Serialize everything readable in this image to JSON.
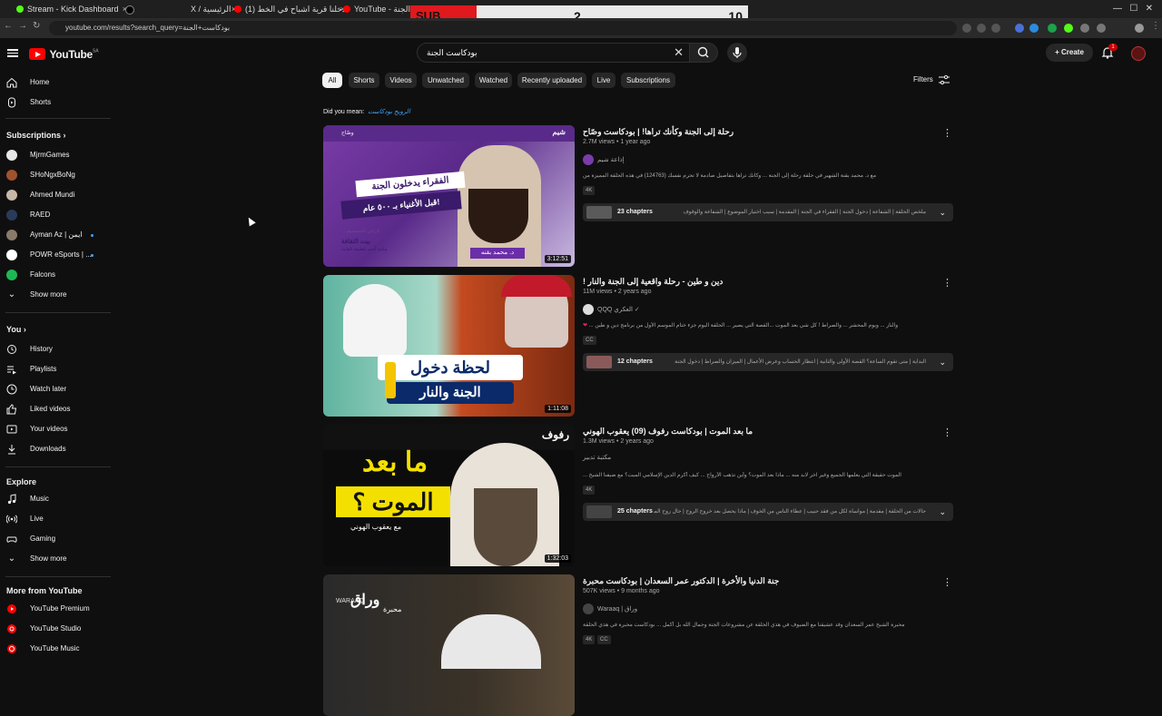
{
  "browser": {
    "tabs": [
      {
        "label": "Stream - Kick Dashboard"
      },
      {
        "label": "X / الرئيسية"
      },
      {
        "label": "(1) دخلنا قرية اشباح في الخط"
      },
      {
        "label": "YouTube - بودكاست الجنة"
      }
    ],
    "url": "youtube.com/results?search_query=بودكاست+الجنة"
  },
  "overlay": {
    "sub_label": "SUB",
    "count": "2",
    "goal": "10"
  },
  "header": {
    "logo_text": "YouTube",
    "region": "SA",
    "search_value": "بودكاست الجنة",
    "create_label": "Create",
    "notif_count": "1"
  },
  "sidebar": {
    "main": [
      {
        "label": "Home"
      },
      {
        "label": "Shorts"
      }
    ],
    "subscriptions_title": "Subscriptions",
    "subscriptions": [
      {
        "label": "MjrmGames"
      },
      {
        "label": "SHoNgxBoNg"
      },
      {
        "label": "Ahmed Mundi"
      },
      {
        "label": "RAED"
      },
      {
        "label": "Ayman Az | ايمن"
      },
      {
        "label": "POWR eSports | ..."
      },
      {
        "label": "Falcons"
      },
      {
        "label": "Show more"
      }
    ],
    "you_title": "You",
    "you": [
      {
        "label": "History"
      },
      {
        "label": "Playlists"
      },
      {
        "label": "Watch later"
      },
      {
        "label": "Liked videos"
      },
      {
        "label": "Your videos"
      },
      {
        "label": "Downloads"
      }
    ],
    "explore_title": "Explore",
    "explore": [
      {
        "label": "Music"
      },
      {
        "label": "Live"
      },
      {
        "label": "Gaming"
      },
      {
        "label": "Show more"
      }
    ],
    "more_title": "More from YouTube",
    "more": [
      {
        "label": "YouTube Premium"
      },
      {
        "label": "YouTube Studio"
      },
      {
        "label": "YouTube Music"
      }
    ]
  },
  "chips": [
    "All",
    "Shorts",
    "Videos",
    "Unwatched",
    "Watched",
    "Recently uploaded",
    "Live",
    "Subscriptions"
  ],
  "filters_label": "Filters",
  "did_you_mean": {
    "label": "Did you mean:",
    "suggestion": "الرويح بودكاست"
  },
  "videos": [
    {
      "title": "رحلة إلى الجنة وكأنك تراها! | بودكاست وصّاح",
      "views": "2.7M views",
      "age": "1 year ago",
      "channel": "إذاعة شيم",
      "desc": "مع د. محمد بقنة الشهير في حلقة رحلة إلى الجنة ... وكأنك تراها بتفاصيل صادمة لا تحرم نفسك (124763) في هذه الحلقة المميزة من",
      "badges": [
        "4K"
      ],
      "chapters_count": "23 chapters",
      "chapters_text": "ملخص الحلقة | الشفاعة | دخول الجنة | الفقراء في الجنة | المقدمة | سبب اختيار الموضوع | الشفاعة والوقوف",
      "duration": "3:12:51",
      "thumb_text": [
        "شيم",
        "وصّاح",
        "الفقراء يدخلون الجنة",
        "قبل الأغنياء بـ ٥٠٠ عام!",
        "د. محمد بقنه",
        "الراعي المستضيف",
        "مكتبة أحمد قطيفة العامة",
        "بيت الثقافة"
      ]
    },
    {
      "title": "! دين و طين - رحلة واقعية إلى الجنة والنار",
      "views": "11M views",
      "age": "2 years ago",
      "channel": "QQQ العكري",
      "desc": "... والنار ... ويوم المحشر ... والصراط ! كل شي بعد الموت ...القصة التي يصير ... الحلقة اليوم جزء ختام الموسم الأول من برنامج دين و طين",
      "badges": [
        "CC"
      ],
      "chapters_count": "12 chapters",
      "chapters_text": "البداية | متى تقوم الساعة؟ القصة الأولى والثانية | انتظار الحساب وعرض الأعمال | الميزان والصراط | دخول الجنة",
      "duration": "1:11:08",
      "thumb_text": [
        "لحظة دخول",
        "الجنة والنار"
      ]
    },
    {
      "title": "ما بعد الموت | بودكاست رفوف (09) يعقوب الهوني",
      "views": "1.3M views",
      "age": "2 years ago",
      "channel": "مكتبة تدبير",
      "desc": "... الموت حقيقة التي يعلمها الجميع وغير آخر لابد منه ... ماذا بعد الموت؟ وأين تذهب الأرواح ... كيف أكرم الدين الإسلامي الميت؟ مع ضيفنا الشيخ",
      "badges": [
        "4K"
      ],
      "chapters_count": "25 chapters",
      "chapters_text": "حالات من الحلقة | مقدمة | مواساة لكل من فقد حبيب | عطاء الناس من الخوف | ماذا يحصل بعد خروج الروح | حال روح المؤمن",
      "duration": "1:32:03",
      "thumb_text": [
        "رفوف",
        "ما بعد",
        "الموت ؟",
        "مع يعقوب الهوني"
      ]
    },
    {
      "title": "جنة الدنيا والأخرة | الدكتور عمر السعدان | بودكاست محبرة",
      "views": "507K views",
      "age": "9 months ago",
      "channel": "Waraaq | وراق",
      "desc": "محبرة الشيخ عمر السعدان وقد عشيقنا مع الضيوف في هذي الحلقة عن مشروعات الجنة وجمال الله بل أكمل ... بودكاست محبرة في هذي الحلقة",
      "badges": [
        "4K",
        "CC"
      ],
      "thumb_text": [
        "وراق",
        "محبرة",
        "WARAAQ"
      ]
    }
  ],
  "colors": {
    "bg": "#0f0f0f",
    "chip": "#272727",
    "accent": "#ff0000",
    "link": "#3ea6ff"
  }
}
